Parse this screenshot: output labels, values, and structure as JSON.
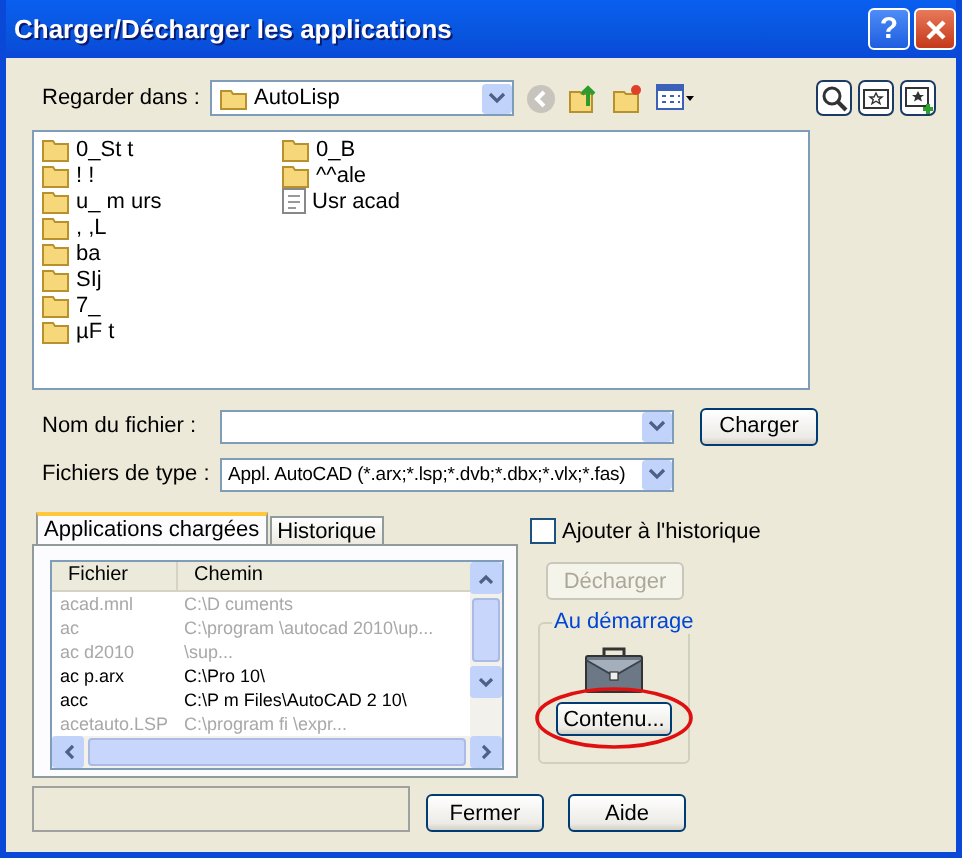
{
  "window": {
    "title": "Charger/Décharger les applications",
    "help": "?"
  },
  "look_in": {
    "label": "Regarder dans :",
    "value": "AutoLisp",
    "back_disabled": true
  },
  "files": [
    {
      "name": "0_St  t"
    },
    {
      "name": "! !"
    },
    {
      "name": "u_ m urs"
    },
    {
      "name": ", ,L"
    },
    {
      "name": "ba"
    },
    {
      "name": "SIj"
    },
    {
      "name": "7_"
    },
    {
      "name": "µF t"
    },
    {
      "name": "0_B"
    },
    {
      "name": "^^ale"
    },
    {
      "name": "Usr acad",
      "kind": "file"
    }
  ],
  "file_name": {
    "label": "Nom du fichier :"
  },
  "load_button": "Charger",
  "file_type": {
    "label": "Fichiers de type :",
    "value": "Appl. AutoCAD (*.arx;*.lsp;*.dvb;*.dbx;*.vlx;*.fas)"
  },
  "tabs": [
    {
      "label": "Applications chargées",
      "selected": true
    },
    {
      "label": "Historique",
      "selected": false
    }
  ],
  "table": {
    "columns": [
      "Fichier",
      "Chemin"
    ],
    "rows": [
      {
        "cells": [
          "acad.mnl",
          "C:\\D  cuments"
        ],
        "dimmed": true
      },
      {
        "cells": [
          "ac",
          "C:\\program  \\autocad 2010\\up..."
        ],
        "dimmed": true
      },
      {
        "cells": [
          "ac d2010",
          "\\sup..."
        ],
        "dimmed": true
      },
      {
        "cells": [
          "ac p.arx",
          "C:\\Pro       10\\"
        ],
        "dimmed": false
      },
      {
        "cells": [
          "acc",
          "C:\\P   m Files\\AutoCAD 2 10\\"
        ],
        "dimmed": false
      },
      {
        "cells": [
          "acetauto.LSP",
          "C:\\program fi   \\expr..."
        ],
        "dimmed": true
      }
    ]
  },
  "add_history": {
    "label": "Ajouter à l'historique",
    "checked": false
  },
  "unload_button": {
    "label": "Décharger",
    "disabled": true
  },
  "startup": {
    "title": "Au démarrage",
    "button": "Contenu...",
    "circled": true
  },
  "buttons": [
    "Fermer",
    "Aide"
  ]
}
